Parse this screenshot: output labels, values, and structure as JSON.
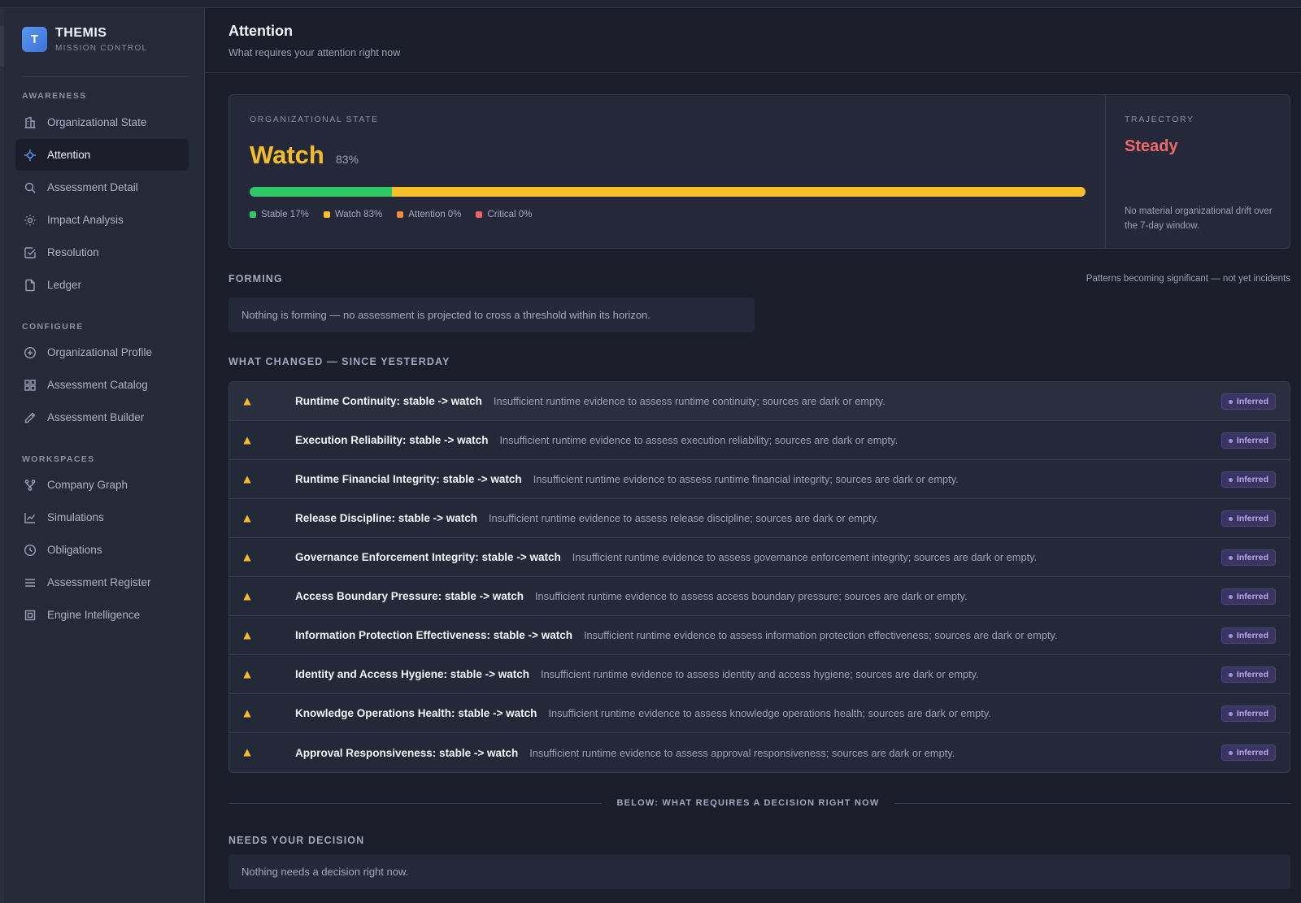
{
  "brand": {
    "logo_letter": "T",
    "name": "THEMIS",
    "subtitle": "MISSION CONTROL"
  },
  "sidebar": {
    "sections": [
      {
        "label": "AWARENESS"
      },
      {
        "label": "CONFIGURE"
      },
      {
        "label": "WORKSPACES"
      }
    ],
    "items": [
      {
        "label": "Organizational State",
        "icon": "building-icon"
      },
      {
        "label": "Attention",
        "icon": "crosshair-icon",
        "active": true
      },
      {
        "label": "Assessment Detail",
        "icon": "search-icon"
      },
      {
        "label": "Impact Analysis",
        "icon": "sun-icon"
      },
      {
        "label": "Resolution",
        "icon": "check-square-icon"
      },
      {
        "label": "Ledger",
        "icon": "file-icon"
      },
      {
        "label": "Organizational Profile",
        "icon": "plus-circle-icon"
      },
      {
        "label": "Assessment Catalog",
        "icon": "grid-icon"
      },
      {
        "label": "Assessment Builder",
        "icon": "pencil-icon"
      },
      {
        "label": "Company Graph",
        "icon": "branch-icon"
      },
      {
        "label": "Simulations",
        "icon": "line-chart-icon"
      },
      {
        "label": "Obligations",
        "icon": "clock-icon"
      },
      {
        "label": "Assessment Register",
        "icon": "list-icon"
      },
      {
        "label": "Engine Intelligence",
        "icon": "chip-icon"
      }
    ]
  },
  "header": {
    "title": "Attention",
    "subtitle": "What requires your attention right now"
  },
  "org_state": {
    "label": "ORGANIZATIONAL STATE",
    "value": "Watch",
    "percent": "83%",
    "distribution": [
      {
        "name": "Stable",
        "label": "Stable 17%",
        "fraction": 0.17,
        "color": "#2ec866"
      },
      {
        "name": "Watch",
        "label": "Watch 83%",
        "fraction": 0.83,
        "color": "#f7bf2a"
      },
      {
        "name": "Attention",
        "label": "Attention 0%",
        "fraction": 0,
        "color": "#f28a3c"
      },
      {
        "name": "Critical",
        "label": "Critical 0%",
        "fraction": 0,
        "color": "#ec6565"
      }
    ]
  },
  "trajectory": {
    "label": "TRAJECTORY",
    "value": "Steady",
    "note": "No material organizational drift over the 7-day window."
  },
  "forming": {
    "heading": "FORMING",
    "note": "Patterns becoming significant — not yet incidents",
    "empty": "Nothing is forming — no assessment is projected to cross a threshold within its horizon."
  },
  "changes": {
    "heading": "WHAT CHANGED — SINCE YESTERDAY",
    "badge_label": "Inferred",
    "rows": [
      {
        "title": "Runtime Continuity: stable -> watch",
        "desc": "Insufficient runtime evidence to assess runtime continuity; sources are dark or empty."
      },
      {
        "title": "Execution Reliability: stable -> watch",
        "desc": "Insufficient runtime evidence to assess execution reliability; sources are dark or empty."
      },
      {
        "title": "Runtime Financial Integrity: stable -> watch",
        "desc": "Insufficient runtime evidence to assess runtime financial integrity; sources are dark or empty."
      },
      {
        "title": "Release Discipline: stable -> watch",
        "desc": "Insufficient runtime evidence to assess release discipline; sources are dark or empty."
      },
      {
        "title": "Governance Enforcement Integrity: stable -> watch",
        "desc": "Insufficient runtime evidence to assess governance enforcement integrity; sources are dark or empty."
      },
      {
        "title": "Access Boundary Pressure: stable -> watch",
        "desc": "Insufficient runtime evidence to assess access boundary pressure; sources are dark or empty."
      },
      {
        "title": "Information Protection Effectiveness: stable -> watch",
        "desc": "Insufficient runtime evidence to assess information protection effectiveness; sources are dark or empty."
      },
      {
        "title": "Identity and Access Hygiene: stable -> watch",
        "desc": "Insufficient runtime evidence to assess identity and access hygiene; sources are dark or empty."
      },
      {
        "title": "Knowledge Operations Health: stable -> watch",
        "desc": "Insufficient runtime evidence to assess knowledge operations health; sources are dark or empty."
      },
      {
        "title": "Approval Responsiveness: stable -> watch",
        "desc": "Insufficient runtime evidence to assess approval responsiveness; sources are dark or empty."
      }
    ]
  },
  "divider": {
    "label": "BELOW: WHAT REQUIRES A DECISION RIGHT NOW"
  },
  "decision": {
    "heading": "NEEDS YOUR DECISION",
    "empty": "Nothing needs a decision right now."
  },
  "colors": {
    "accent": "#4f8cec",
    "watch": "#f5bd2a",
    "trajectory": "#ee6b6b",
    "badge": "#b9a7f2"
  }
}
